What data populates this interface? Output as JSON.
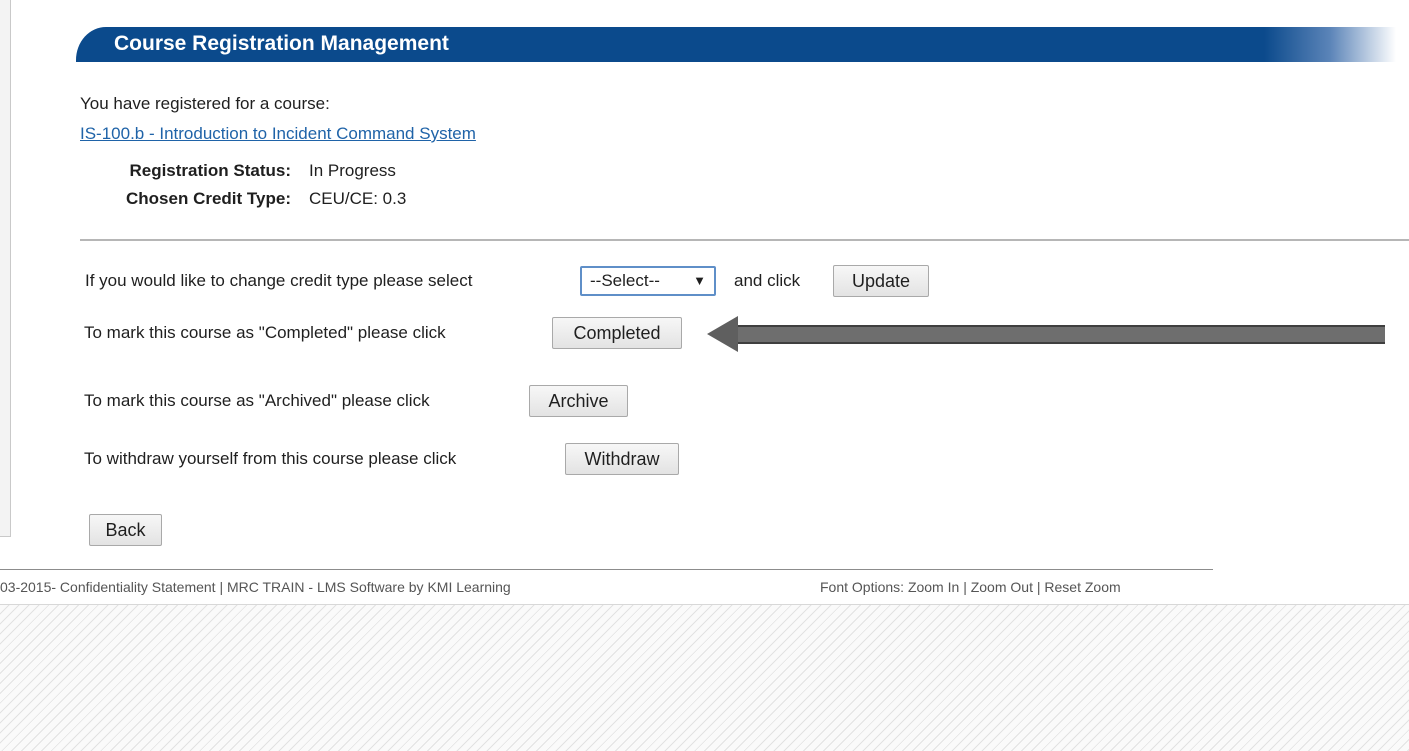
{
  "header": {
    "title": "Course Registration Management"
  },
  "registration": {
    "intro": "You have registered for a course:",
    "course_link": "IS-100.b - Introduction to Incident Command System",
    "status_label": "Registration Status:",
    "status_value": "In Progress",
    "credit_label": "Chosen Credit Type:",
    "credit_value": "CEU/CE: 0.3"
  },
  "actions": {
    "credit_prompt": "If you would like to change credit type please select",
    "credit_select_value": "--Select--",
    "credit_select_arrow": "▼",
    "and_click": "and click",
    "update_button": "Update",
    "completed_prompt": "To mark this course as \"Completed\" please click",
    "completed_button": "Completed",
    "archived_prompt": "To mark this course as \"Archived\" please click",
    "archive_button": "Archive",
    "withdraw_prompt": "To withdraw yourself from this course please click",
    "withdraw_button": "Withdraw",
    "back_button": "Back"
  },
  "annotation": {
    "arrow_color": "#6e6e6e",
    "arrow_icon": "left-arrow-icon"
  },
  "footer": {
    "copyright": "03-2015- Confidentiality Statement | MRC TRAIN - LMS Software by KMI Learning",
    "font_options_label": "Font Options:",
    "zoom_in": "Zoom In",
    "separator": "|",
    "zoom_out": "Zoom Out",
    "reset_zoom": "Reset Zoom"
  },
  "colors": {
    "header_blue": "#0b4a8c",
    "link_blue": "#1f63a8"
  }
}
